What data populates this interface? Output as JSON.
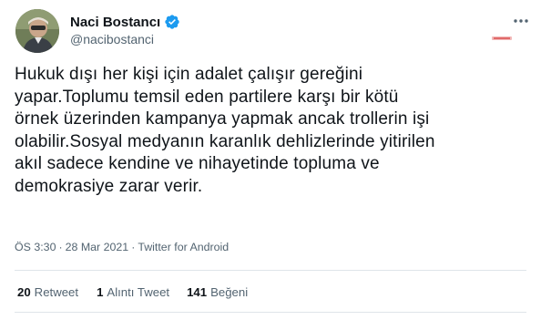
{
  "author": {
    "display_name": "Naci Bostancı",
    "handle": "@nacibostanci",
    "verified": true
  },
  "tweet": {
    "lines": [
      "Hukuk dışı her kişi için adalet çalışır gereğini",
      "yapar.Toplumu temsil eden partilere karşı bir kötü",
      "örnek üzerinden kampanya yapmak ancak trollerin işi",
      "olabilir.Sosyal medyanın karanlık dehlizlerinde yitirilen",
      "akıl sadece kendine ve nihayetinde topluma ve",
      "demokrasiye zarar verir."
    ]
  },
  "meta": {
    "time": "ÖS 3:30",
    "separator": "·",
    "date": "28 Mar 2021",
    "source": "Twitter for Android"
  },
  "stats": {
    "retweets": {
      "count": "20",
      "label": "Retweet"
    },
    "quotes": {
      "count": "1",
      "label": "Alıntı Tweet"
    },
    "likes": {
      "count": "141",
      "label": "Beğeni"
    }
  },
  "icons": {
    "verified": "verified-badge-icon",
    "more": "more-options-icon"
  },
  "colors": {
    "verified": "#1d9bf0",
    "text_primary": "#0f1419",
    "text_secondary": "#536471",
    "divider": "#dfe5e9"
  }
}
